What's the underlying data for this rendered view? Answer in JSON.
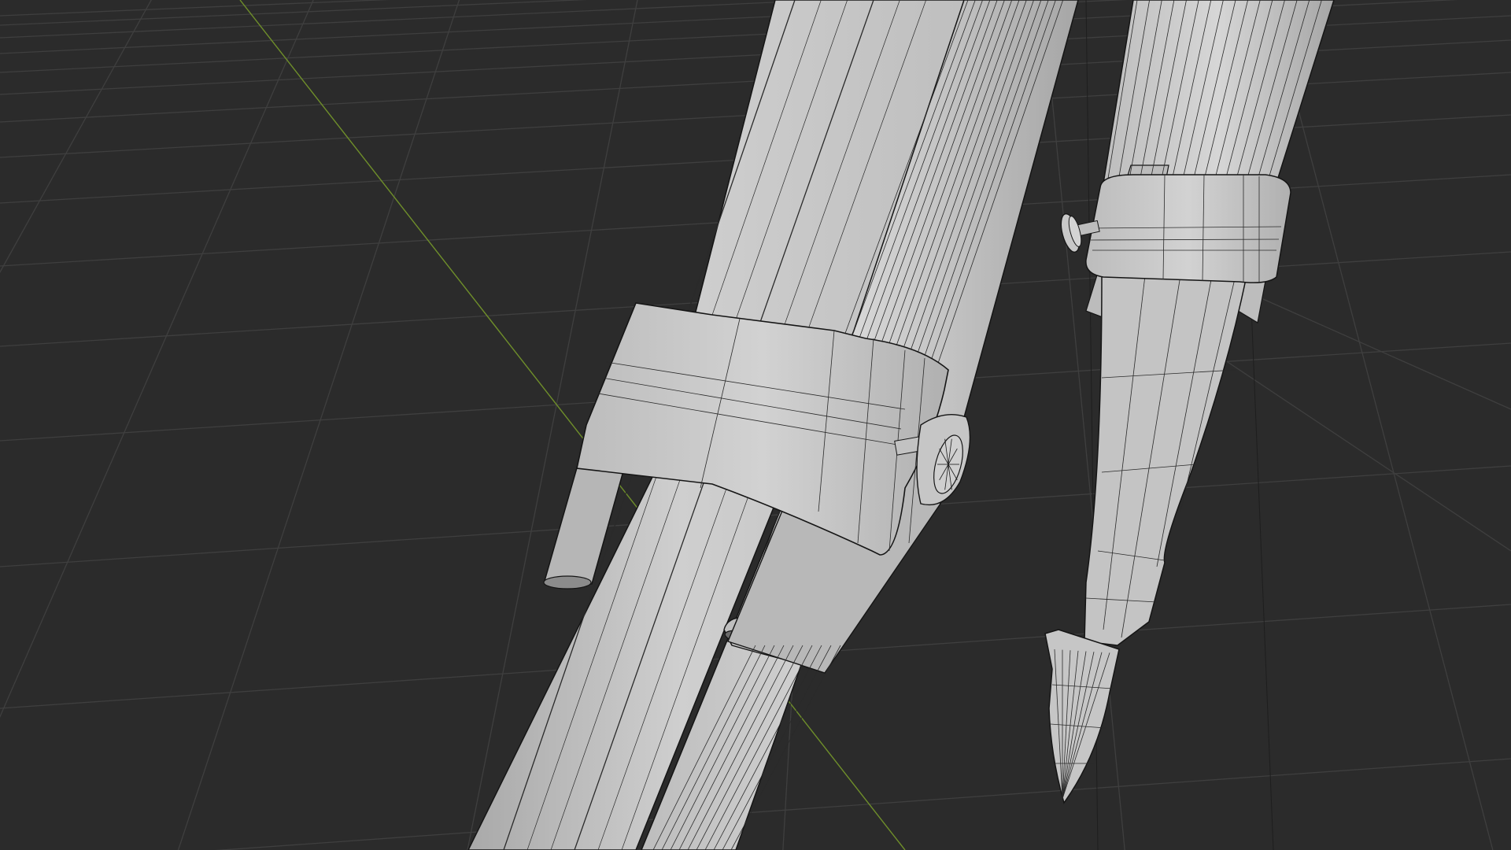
{
  "app": {
    "view": "3D Viewport",
    "shading": "solid-wireframe",
    "background_color": "#2b2b2b"
  },
  "viewport": {
    "grid_line_color": "#3f3f3f",
    "axis_y_color": "#6f8f2a",
    "mesh_fill_color": "#c4c4c4",
    "mesh_edge_color": "#151515",
    "objects": [
      {
        "name": "tripod-leg-front",
        "icon": "mesh-icon"
      },
      {
        "name": "tripod-leg-back",
        "icon": "mesh-icon"
      },
      {
        "name": "leg-clamp-front",
        "icon": "mesh-icon"
      },
      {
        "name": "leg-clamp-back",
        "icon": "mesh-icon"
      },
      {
        "name": "clamp-screw-knob-front",
        "icon": "mesh-icon"
      },
      {
        "name": "clamp-screw-knob-back",
        "icon": "mesh-icon"
      },
      {
        "name": "leg-spike-foot",
        "icon": "mesh-icon"
      }
    ]
  }
}
